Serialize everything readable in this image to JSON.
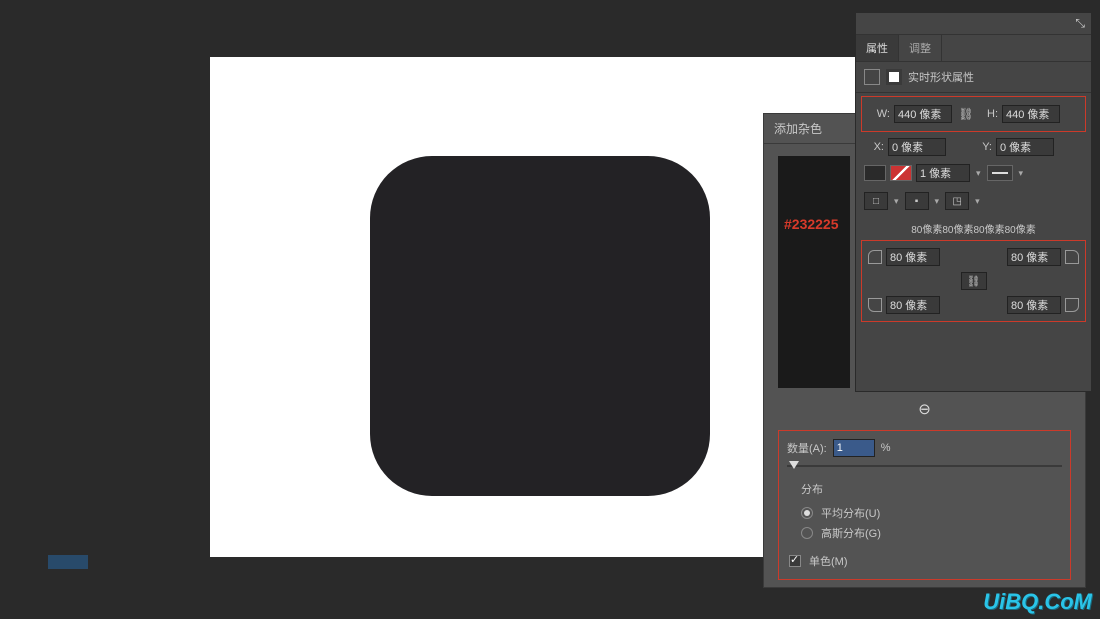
{
  "canvas": {
    "hex_code": "#232225"
  },
  "noise_panel": {
    "title": "添加杂色",
    "amount_label": "数量(A):",
    "amount_value": "1",
    "amount_unit": "%",
    "distribution_label": "分布",
    "uniform_label": "平均分布(U)",
    "gaussian_label": "高斯分布(G)",
    "mono_label": "单色(M)"
  },
  "props": {
    "tab_props": "属性",
    "tab_adjust": "调整",
    "live_shape": "实时形状属性",
    "w_label": "W:",
    "w_value": "440 像素",
    "h_label": "H:",
    "h_value": "440 像素",
    "x_label": "X:",
    "x_value": "0 像素",
    "y_label": "Y:",
    "y_value": "0 像素",
    "stroke_width": "1 像素",
    "corners_summary": "80像素80像素80像素80像素",
    "corner_tl": "80 像素",
    "corner_tr": "80 像素",
    "corner_bl": "80 像素",
    "corner_br": "80 像素"
  },
  "watermark": "UiBQ.CoM"
}
